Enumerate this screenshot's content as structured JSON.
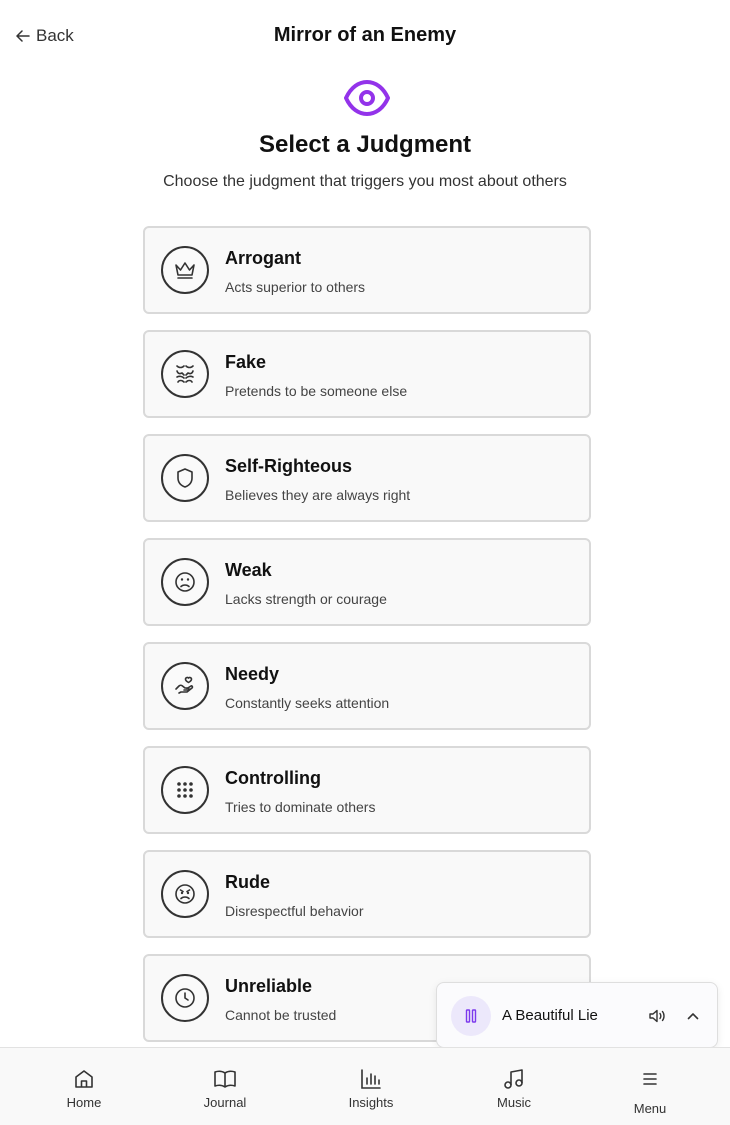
{
  "header": {
    "back_label": "Back",
    "title": "Mirror of an Enemy"
  },
  "intro": {
    "heading": "Select a Judgment",
    "subheading": "Choose the judgment that triggers you most about others"
  },
  "judgments": [
    {
      "label": "Arrogant",
      "description": "Acts superior to others",
      "icon": "crown-icon"
    },
    {
      "label": "Fake",
      "description": "Pretends to be someone else",
      "icon": "mask-icon"
    },
    {
      "label": "Self-Righteous",
      "description": "Believes they are always right",
      "icon": "shield-icon"
    },
    {
      "label": "Weak",
      "description": "Lacks strength or courage",
      "icon": "frown-icon"
    },
    {
      "label": "Needy",
      "description": "Constantly seeks attention",
      "icon": "hand-heart-icon"
    },
    {
      "label": "Controlling",
      "description": "Tries to dominate others",
      "icon": "grip-icon"
    },
    {
      "label": "Rude",
      "description": "Disrespectful behavior",
      "icon": "angry-icon"
    },
    {
      "label": "Unreliable",
      "description": "Cannot be trusted",
      "icon": "clock-icon"
    }
  ],
  "player": {
    "song": "A Beautiful Lie",
    "accent": "#7c3aed"
  },
  "nav": {
    "items": [
      {
        "label": "Home",
        "icon": "home-icon"
      },
      {
        "label": "Journal",
        "icon": "book-icon"
      },
      {
        "label": "Insights",
        "icon": "bar-chart-icon"
      },
      {
        "label": "Music",
        "icon": "music-icon"
      },
      {
        "label": "Menu",
        "icon": "menu-icon"
      }
    ]
  },
  "colors": {
    "accent": "#9333ea",
    "card_bg": "#f9f9f9",
    "card_border": "#d9d9d9"
  }
}
